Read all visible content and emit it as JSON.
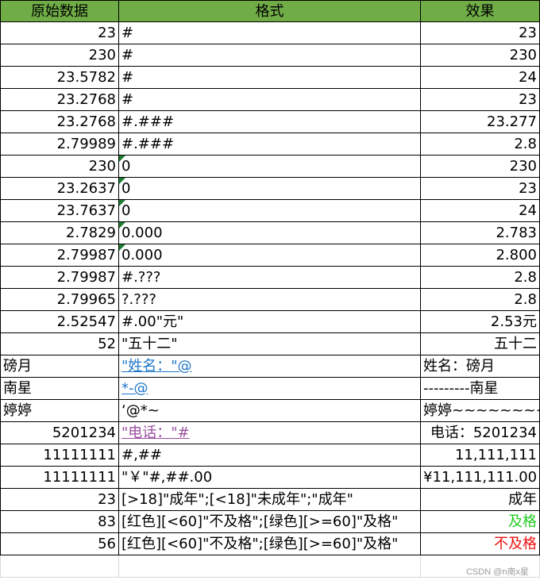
{
  "header": {
    "col1": "原始数据",
    "col2": "格式",
    "col3": "效果"
  },
  "rows": [
    {
      "raw": "23",
      "fmt": "#",
      "result": "23"
    },
    {
      "raw": "230",
      "fmt": "#",
      "result": "230"
    },
    {
      "raw": "23.5782",
      "fmt": "#",
      "result": "24"
    },
    {
      "raw": "23.2768",
      "fmt": "#",
      "result": "23"
    },
    {
      "raw": "23.2768",
      "fmt": "#.###",
      "result": "23.277"
    },
    {
      "raw": "2.79989",
      "fmt": "#.###",
      "result": "2.8"
    },
    {
      "raw": "230",
      "fmt": "0",
      "result": "230"
    },
    {
      "raw": "23.2637",
      "fmt": "0",
      "result": "23"
    },
    {
      "raw": "23.7637",
      "fmt": "0",
      "result": "24"
    },
    {
      "raw": "2.7829",
      "fmt": "0.000",
      "result": "2.783"
    },
    {
      "raw": "2.79987",
      "fmt": "0.000",
      "result": "2.800"
    },
    {
      "raw": "2.79987",
      "fmt": "#.???",
      "result": "2.8"
    },
    {
      "raw": "2.79965",
      "fmt": "?.???",
      "result": "2.8"
    },
    {
      "raw": "2.52547",
      "fmt": "#.00\"元\"",
      "result": "2.53元"
    },
    {
      "raw": "52",
      "fmt": "\"五十二\"",
      "result": "五十二"
    },
    {
      "raw": "磅月",
      "fmt": "\"姓名：\"@",
      "result": "姓名：磅月"
    },
    {
      "raw": "南星",
      "fmt": "*-@",
      "result": "---------南星"
    },
    {
      "raw": "婷婷",
      "fmt": "‘@*~",
      "result": "婷婷~~~~~~~~"
    },
    {
      "raw": "5201234",
      "fmt": "\"电话：\"#",
      "result": "电话：5201234"
    },
    {
      "raw": "11111111",
      "fmt": "#,##",
      "result": "11,111,111"
    },
    {
      "raw": "11111111",
      "fmt": "\"￥\"#,##.00",
      "result": "¥11,111,111.00"
    },
    {
      "raw": "23",
      "fmt": "[>18]\"成年\";[<18]\"未成年\";\"成年\"",
      "result": "成年"
    },
    {
      "raw": "83",
      "fmt": "[红色][<60]\"不及格\";[绿色][>=60]\"及格\"",
      "result": "及格"
    },
    {
      "raw": "56",
      "fmt": "[红色][<60]\"不及格\";[绿色][>=60]\"及格\"",
      "result": "不及格"
    }
  ],
  "colors": {
    "header_bg": "#70ad47",
    "pass": "#22cc22",
    "fail": "#ee1111",
    "link_blue": "#1f77c8",
    "link_purple": "#9a4ea1",
    "triangle": "#1e7f32"
  },
  "watermark": "CSDN @n南x星"
}
